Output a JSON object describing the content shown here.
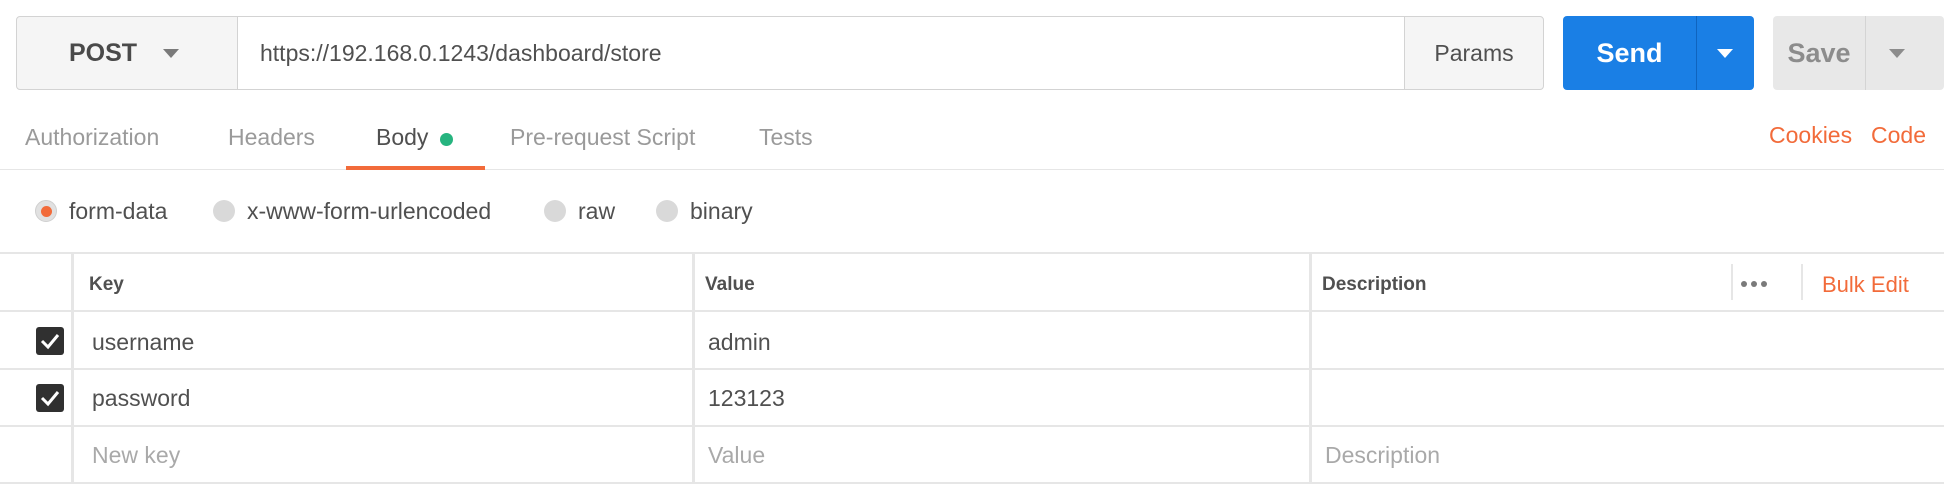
{
  "request": {
    "method": "POST",
    "url": "https://192.168.0.1243/dashboard/store",
    "params_label": "Params",
    "send_label": "Send",
    "save_label": "Save"
  },
  "tabs": [
    {
      "label": "Authorization",
      "active": false
    },
    {
      "label": "Headers",
      "active": false
    },
    {
      "label": "Body",
      "active": true,
      "indicator": "green-dot"
    },
    {
      "label": "Pre-request Script",
      "active": false
    },
    {
      "label": "Tests",
      "active": false
    }
  ],
  "top_links": {
    "cookies": "Cookies",
    "code": "Code"
  },
  "body_types": [
    {
      "label": "form-data",
      "selected": true
    },
    {
      "label": "x-www-form-urlencoded",
      "selected": false
    },
    {
      "label": "raw",
      "selected": false
    },
    {
      "label": "binary",
      "selected": false
    }
  ],
  "table": {
    "headers": {
      "key": "Key",
      "value": "Value",
      "description": "Description"
    },
    "bulk_edit": "Bulk Edit",
    "rows": [
      {
        "checked": true,
        "key": "username",
        "value": "admin",
        "description": ""
      },
      {
        "checked": true,
        "key": "password",
        "value": "123123",
        "description": ""
      }
    ],
    "new_row": {
      "key_placeholder": "New key",
      "value_placeholder": "Value",
      "description_placeholder": "Description"
    }
  },
  "colors": {
    "accent": "#f26b3a",
    "send_blue": "#1a7fe5",
    "dot_green": "#26b47f"
  }
}
